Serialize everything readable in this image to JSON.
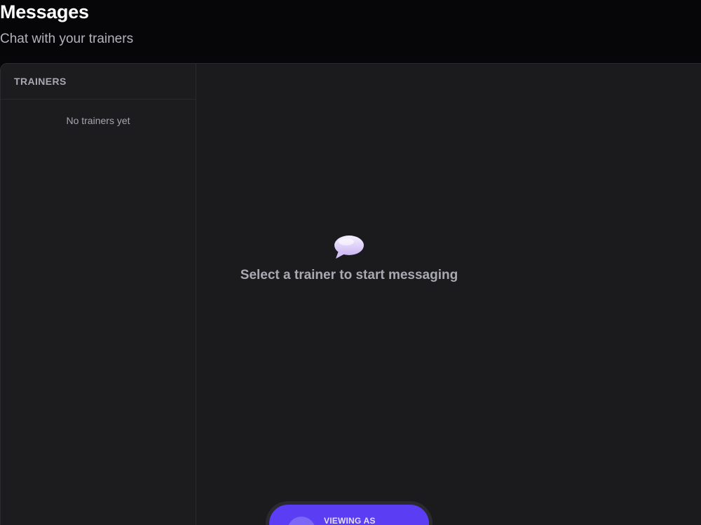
{
  "header": {
    "title": "Messages",
    "subtitle": "Chat with your trainers"
  },
  "sidebar": {
    "title": "TRAINERS",
    "empty_text": "No trainers yet"
  },
  "main": {
    "empty_icon": "speech-bubble-icon",
    "empty_text": "Select a trainer to start messaging"
  },
  "viewing_pill": {
    "label": "VIEWING AS"
  },
  "colors": {
    "accent": "#5b3df3",
    "background": "#0a0a0c",
    "panel": "#1b1b1e"
  }
}
